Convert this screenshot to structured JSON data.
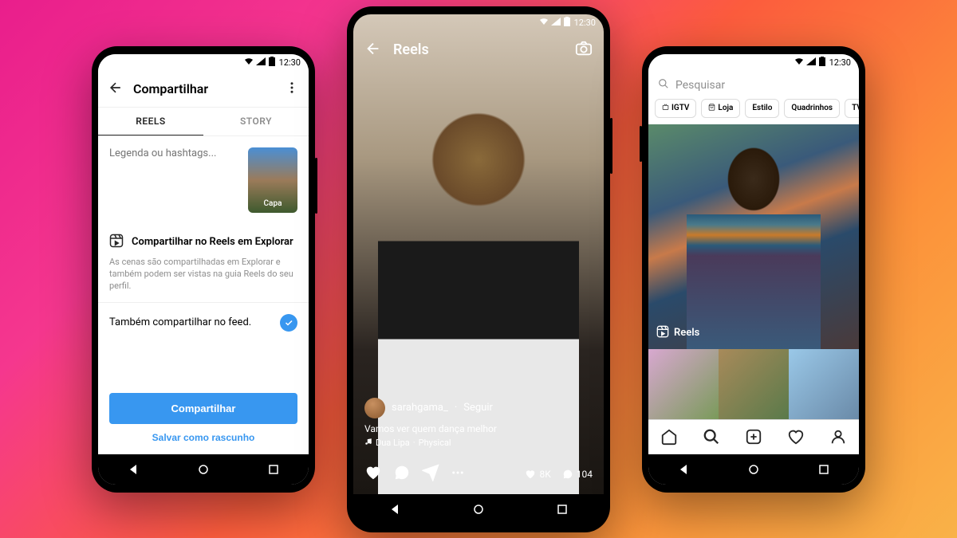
{
  "status": {
    "time": "12:30"
  },
  "phone1": {
    "header_title": "Compartilhar",
    "tabs": {
      "reels": "REELS",
      "story": "STORY"
    },
    "caption_placeholder": "Legenda ou hashtags...",
    "thumbnail_label": "Capa",
    "explore_section": {
      "title": "Compartilhar no Reels em Explorar",
      "desc": "As cenas são compartilhadas em Explorar e também podem ser vistas na guia Reels do seu perfil."
    },
    "feed_toggle_label": "Também compartilhar no feed.",
    "share_button": "Compartilhar",
    "draft_button": "Salvar como rascunho"
  },
  "phone2": {
    "header_title": "Reels",
    "username": "sarahgama_",
    "separator": "·",
    "follow_label": "Seguir",
    "caption": "Vamos ver quem dança melhor",
    "music_artist": "Dua Lipa",
    "music_track": "Physical",
    "likes": "8K",
    "comments": "104"
  },
  "phone3": {
    "search_placeholder": "Pesquisar",
    "chips": [
      "IGTV",
      "Loja",
      "Estilo",
      "Quadrinhos",
      "TV e cinema"
    ],
    "featured_badge": "Reels"
  }
}
